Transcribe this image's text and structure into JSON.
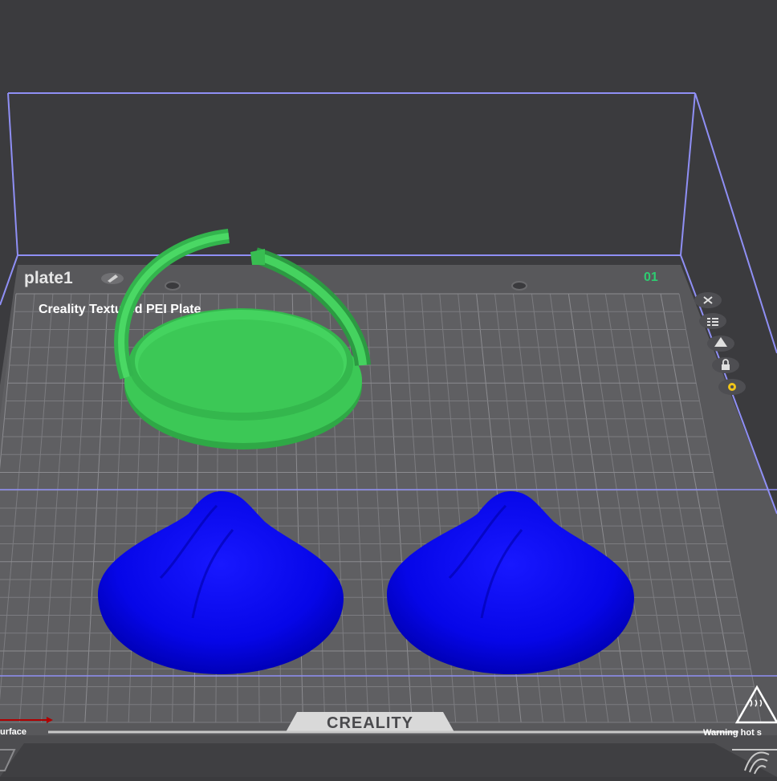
{
  "plate": {
    "name": "plate1",
    "number": "01",
    "bed_label": "Creality Textured PEI Plate",
    "brand": "CREALITY",
    "left_caption": "urface",
    "right_caption": "Warning hot s"
  },
  "plate_tools": [
    {
      "name": "close-plate-button",
      "icon": "close-icon"
    },
    {
      "name": "arrange-plate-button",
      "icon": "arrange-icon"
    },
    {
      "name": "auto-orient-button",
      "icon": "orient-icon"
    },
    {
      "name": "lock-plate-button",
      "icon": "lock-icon"
    },
    {
      "name": "plate-settings-button",
      "icon": "gear-icon"
    }
  ],
  "objects": [
    {
      "name": "green-lid-with-hinged-ring",
      "color": "#3cc856"
    },
    {
      "name": "blue-cone-model-left",
      "color": "#0a0af2"
    },
    {
      "name": "blue-cone-model-right",
      "color": "#0a0af2"
    }
  ],
  "colors": {
    "background": "#3b3b3e",
    "bed": "#5b5b5e",
    "grid": "#7a7a7e",
    "volume_outline": "#8f8ff5",
    "accent_number": "#2ecc71",
    "gear_icon": "#f0c419"
  }
}
